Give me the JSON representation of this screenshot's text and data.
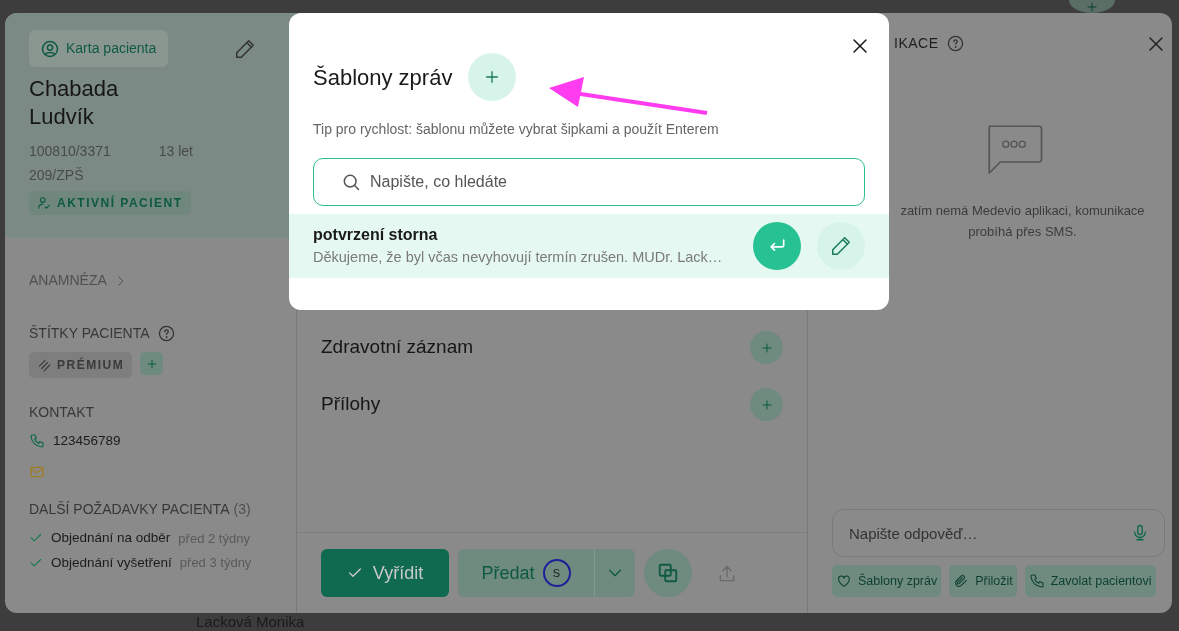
{
  "background": {
    "footer_text": "Lacková Monika"
  },
  "patient": {
    "card_button": "Karta pacienta",
    "surname": "Chabada",
    "first_name": "Ludvík",
    "birth_number": "100810/3371",
    "age": "13 let",
    "insurance": "209/ZPŠ",
    "status_badge": "AKTIVNÍ PACIENT",
    "anamnesis_link": "ANAMNÉZA",
    "tags_heading": "ŠTÍTKY PACIENTA",
    "tags": [
      {
        "label": "PRÉMIUM"
      }
    ],
    "contact_heading": "KONTAKT",
    "phone": "123456789",
    "requests_heading": "DALŠÍ POŽADAVKY PACIENTA",
    "requests_count": "(3)",
    "requests": [
      {
        "label": "Objednání na odběr",
        "time": "před 2 týdny",
        "done": true
      },
      {
        "label": "Objednání vyšetření",
        "time": "před 3 týdny",
        "done": true
      }
    ]
  },
  "sections": [
    {
      "title": "Zdravotní záznam"
    },
    {
      "title": "Přílohy"
    }
  ],
  "actions": {
    "resolve_button": "Vyřídit",
    "handover_button": "Předat",
    "assignee_initial": "S"
  },
  "communication": {
    "title": "IKACE",
    "empty_text": "zatím nemá Medevio aplikaci, komunikace probíhá přes SMS.",
    "reply_placeholder": "Napište odpověď…",
    "chips": [
      {
        "label": "Šablony zpráv",
        "kind": "templates"
      },
      {
        "label": "Přiložit",
        "kind": "attach"
      },
      {
        "label": "Zavolat pacientovi",
        "kind": "call"
      }
    ]
  },
  "modal": {
    "title": "Šablony zpráv",
    "tip": "Tip pro rychlost: šablonu můžete vybrat šipkami a použít Enterem",
    "search_placeholder": "Napište, co hledáte",
    "templates": [
      {
        "title": "potvrzení storna",
        "preview": "Děkujeme, že byl včas nevyhovují termín zrušen. MUDr. Lack…",
        "selected": true
      }
    ]
  }
}
